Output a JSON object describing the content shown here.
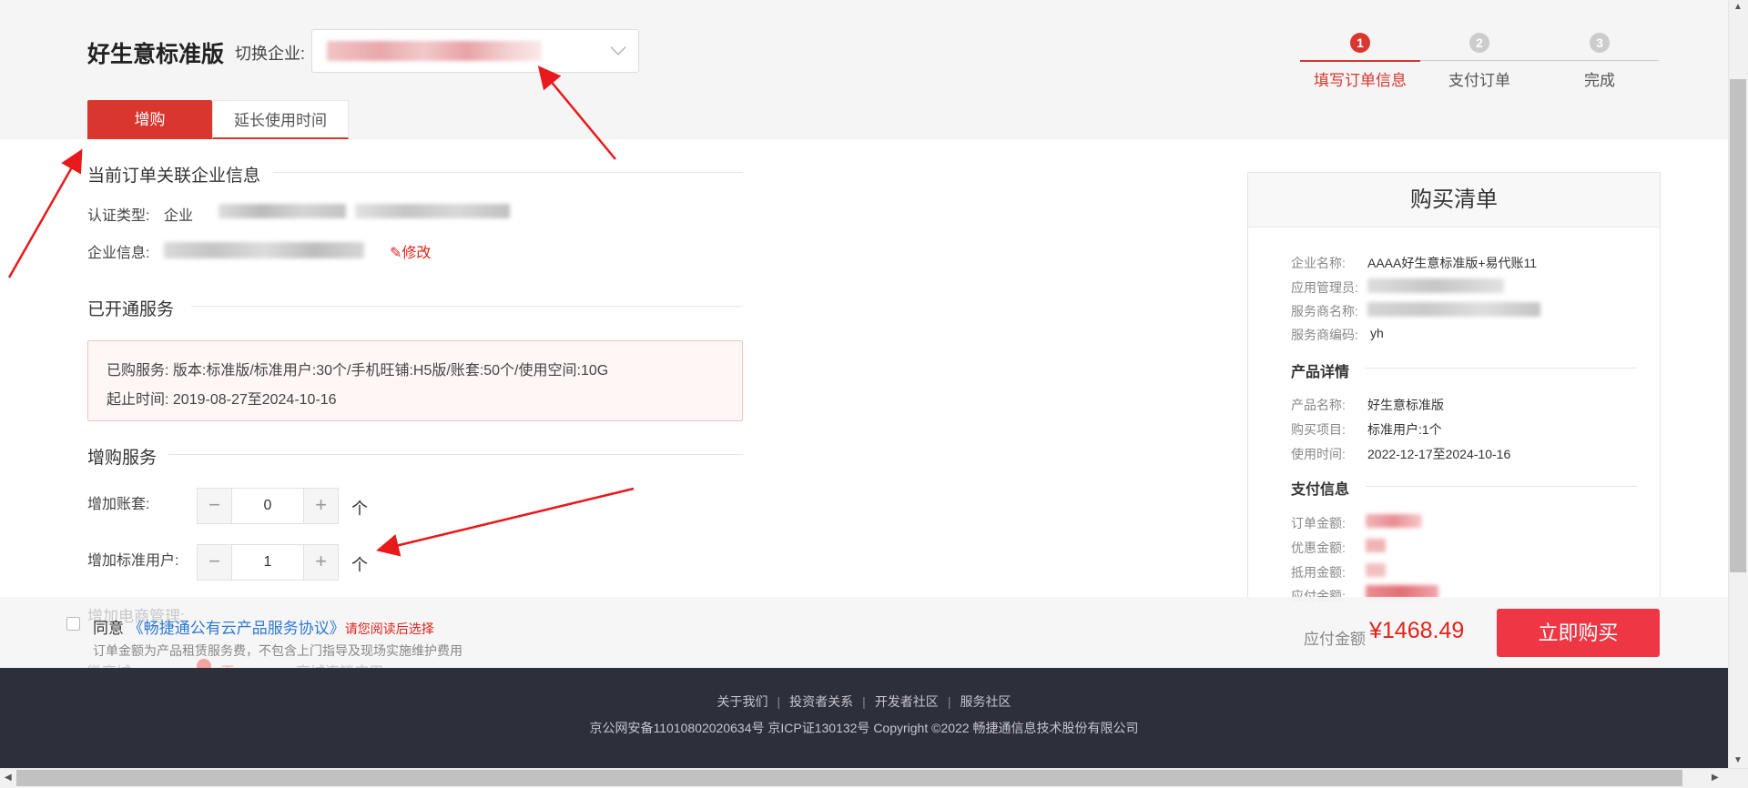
{
  "header": {
    "brand": "好生意标准版",
    "switch_label": "切换企业:",
    "tabs": [
      {
        "label": "增购",
        "active": true
      },
      {
        "label": "延长使用时间",
        "active": false
      }
    ],
    "steps": [
      {
        "num": "1",
        "label": "填写订单信息",
        "active": true
      },
      {
        "num": "2",
        "label": "支付订单",
        "active": false
      },
      {
        "num": "3",
        "label": "完成",
        "active": false
      }
    ]
  },
  "company_info": {
    "title": "当前订单关联企业信息",
    "auth_label": "认证类型:",
    "auth_value": "企业",
    "info_label": "企业信息:",
    "edit_label": "修改"
  },
  "services": {
    "title": "已开通服务",
    "purchased": "已购服务:  版本:标准版/标准用户:30个/手机旺铺:H5版/账套:50个/使用空间:10G",
    "period": "起止时间:  2019-08-27至2024-10-16"
  },
  "addon": {
    "title": "增购服务",
    "items": [
      {
        "label": "增加账套:",
        "value": "0",
        "unit": "个"
      },
      {
        "label": "增加标准用户:",
        "value": "1",
        "unit": "个"
      }
    ],
    "faded_row1": "增加电商管理:",
    "faded_row2_a": "微商城:",
    "faded_row2_b": "无",
    "faded_row2_c": "商城连锁应用"
  },
  "cart": {
    "title": "购买清单",
    "company_rows": [
      {
        "key": "企业名称:",
        "value": "AAAA好生意标准版+易代账11"
      },
      {
        "key": "应用管理员:",
        "value": ""
      },
      {
        "key": "服务商名称:",
        "value": ""
      },
      {
        "key": "服务商编码:",
        "value": "yh"
      }
    ],
    "product_title": "产品详情",
    "product_rows": [
      {
        "key": "产品名称:",
        "value": "好生意标准版"
      },
      {
        "key": "购买项目:",
        "value": "标准用户:1个"
      },
      {
        "key": "使用时间:",
        "value": "2022-12-17至2024-10-16"
      }
    ],
    "pay_title": "支付信息",
    "pay_rows": [
      {
        "key": "订单金额:"
      },
      {
        "key": "优惠金额:"
      },
      {
        "key": "抵用金额:"
      },
      {
        "key": "应付金额:"
      }
    ]
  },
  "bottom_bar": {
    "agree": "同意",
    "agreement_link": "《畅捷通公有云产品服务协议》",
    "warn": "请您阅读后选择",
    "note": "订单金额为产品租赁服务费，不包含上门指导及现场实施维护费用",
    "pay_label": "应付金额",
    "pay_amount": "¥1468.49",
    "buy_label": "立即购买"
  },
  "footer": {
    "links": [
      "关于我们",
      "投资者关系",
      "开发者社区",
      "服务社区"
    ],
    "copyright": "京公网安备11010802020634号 京ICP证130132号 Copyright ©2022 畅捷通信息技术股份有限公司"
  },
  "colors": {
    "brand_red": "#d9362e",
    "buy_button": "#ee3644",
    "link_blue": "#2d79d2",
    "footer_bg": "#2d2f3b",
    "annotation_red": "#e8191a"
  }
}
